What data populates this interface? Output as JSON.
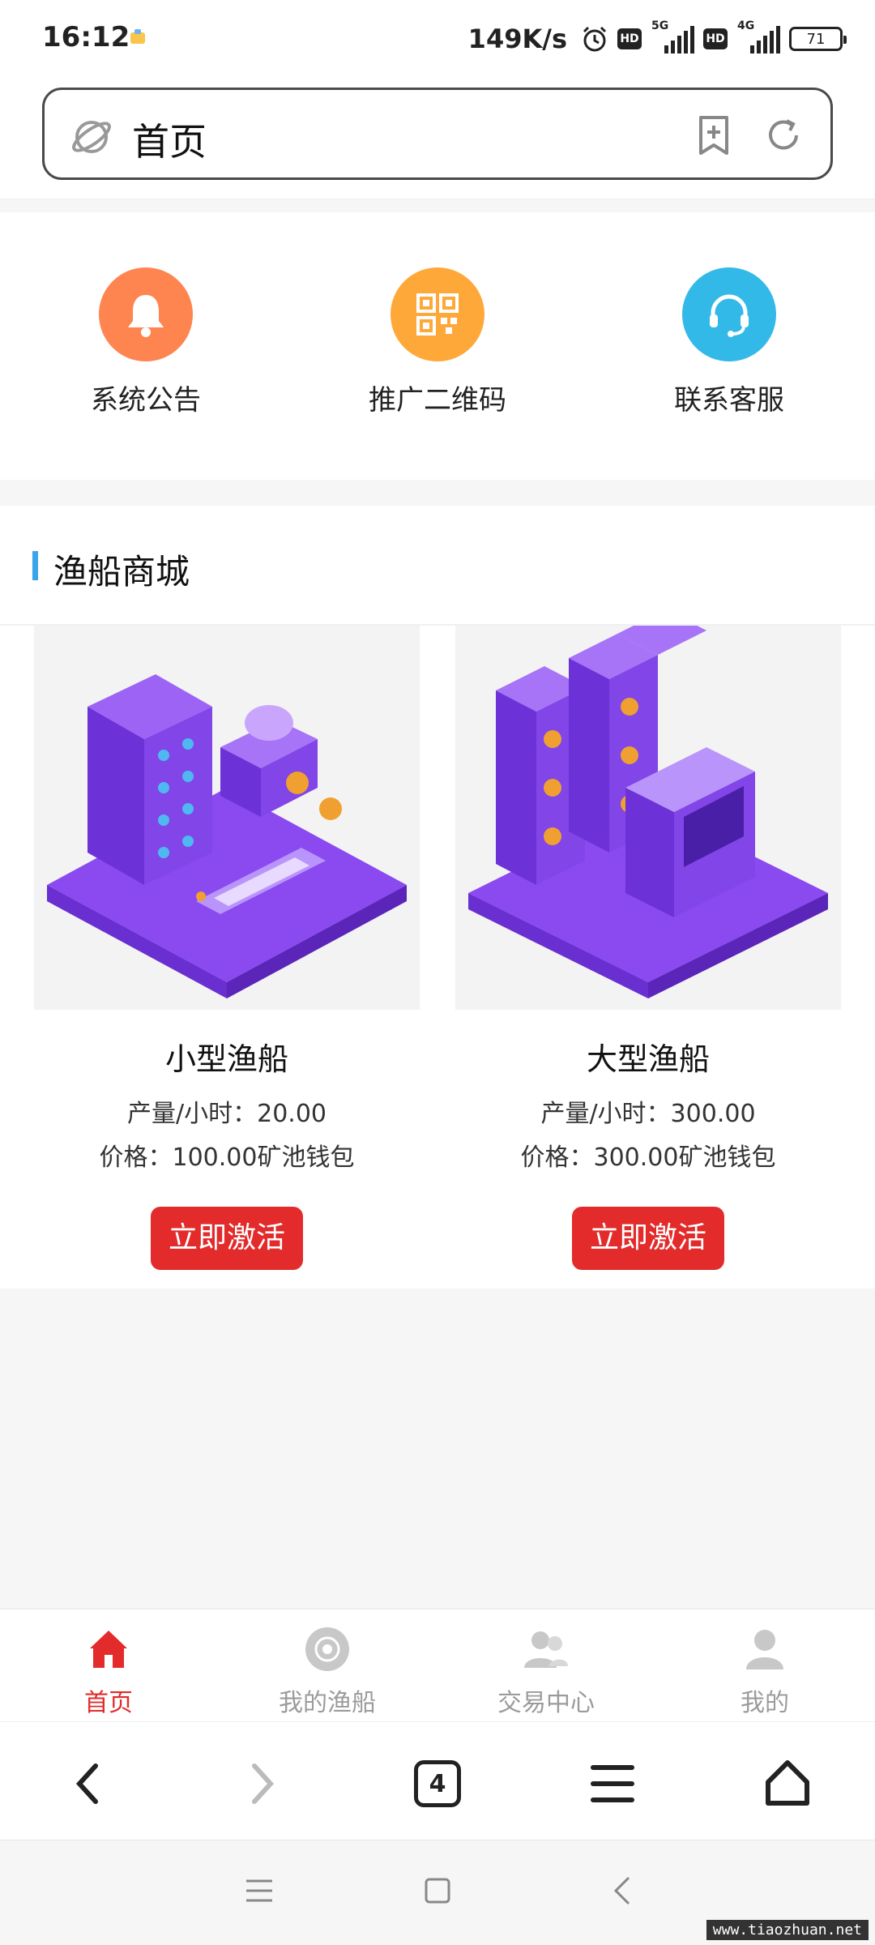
{
  "status_bar": {
    "time": "16:12",
    "net_speed": "149K/s",
    "sim1_label": "5G",
    "sim2_label": "4G",
    "hd_label": "HD",
    "battery": "71"
  },
  "browser": {
    "url_text": "首页",
    "tab_count": "4"
  },
  "quick_entries": [
    {
      "label": "系统公告",
      "icon": "bell-icon",
      "color": "#ff8550"
    },
    {
      "label": "推广二维码",
      "icon": "qrcode-icon",
      "color": "#ffa83a"
    },
    {
      "label": "联系客服",
      "icon": "headset-icon",
      "color": "#33b9e8"
    }
  ],
  "mall": {
    "title": "渔船商城",
    "products": [
      {
        "name": "小型渔船",
        "rate": "产量/小时：20.00",
        "price": "价格：100.00矿池钱包",
        "button": "立即激活"
      },
      {
        "name": "大型渔船",
        "rate": "产量/小时：300.00",
        "price": "价格：300.00矿池钱包",
        "button": "立即激活"
      }
    ]
  },
  "tabbar": [
    {
      "label": "首页",
      "icon": "home-icon",
      "active": true
    },
    {
      "label": "我的渔船",
      "icon": "boat-icon",
      "active": false
    },
    {
      "label": "交易中心",
      "icon": "users-icon",
      "active": false
    },
    {
      "label": "我的",
      "icon": "user-icon",
      "active": false
    }
  ],
  "colors": {
    "accent_red": "#e32b2b",
    "accent_blue": "#3aa5e8",
    "product_purple": "#7b3fe4"
  },
  "watermark": "www.tiaozhuan.net"
}
